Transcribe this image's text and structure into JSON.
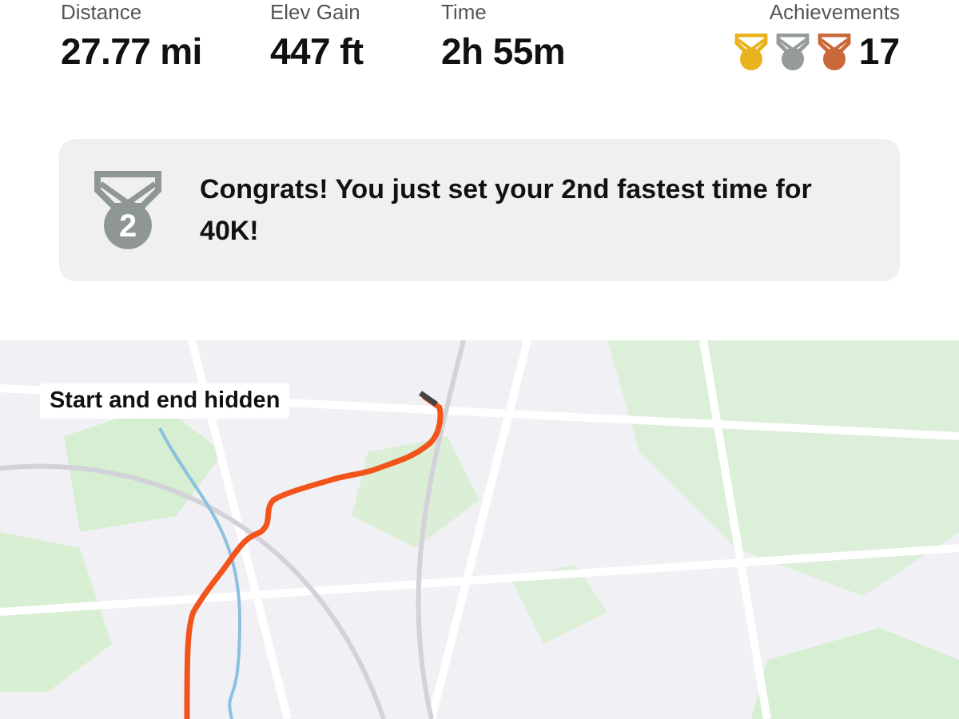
{
  "stats": [
    {
      "label": "Distance",
      "value": "27.77 mi"
    },
    {
      "label": "Elev Gain",
      "value": "447 ft"
    },
    {
      "label": "Time",
      "value": "2h 55m"
    }
  ],
  "achievements": {
    "label": "Achievements",
    "count": "17",
    "medals": [
      {
        "color": "#e8b31c"
      },
      {
        "color": "#959b9b"
      },
      {
        "color": "#c9693a"
      }
    ]
  },
  "banner": {
    "medal_rank": "2",
    "text": "Congrats! You just set your 2nd fastest time for 40K!"
  },
  "map": {
    "overlay_label": "Start and end hidden"
  }
}
